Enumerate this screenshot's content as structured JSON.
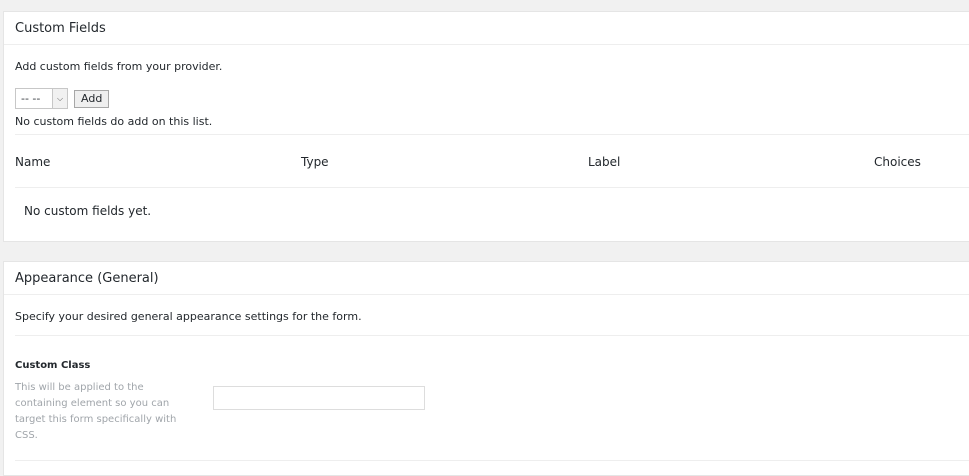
{
  "custom_fields": {
    "title": "Custom Fields",
    "description": "Add custom fields from your provider.",
    "select_value": "-- --",
    "add_button": "Add",
    "status_note": "No custom fields do add on this list.",
    "columns": [
      "Name",
      "Type",
      "Label",
      "Choices"
    ],
    "empty_message": "No custom fields yet."
  },
  "appearance": {
    "title": "Appearance (General)",
    "description": "Specify your desired general appearance settings for the form.",
    "custom_class_label": "Custom Class",
    "custom_class_help": "This will be applied to the containing element so you can target this form specifically with CSS.",
    "custom_class_value": ""
  },
  "icons": {
    "select_arrow": "chevron-down-icon"
  }
}
